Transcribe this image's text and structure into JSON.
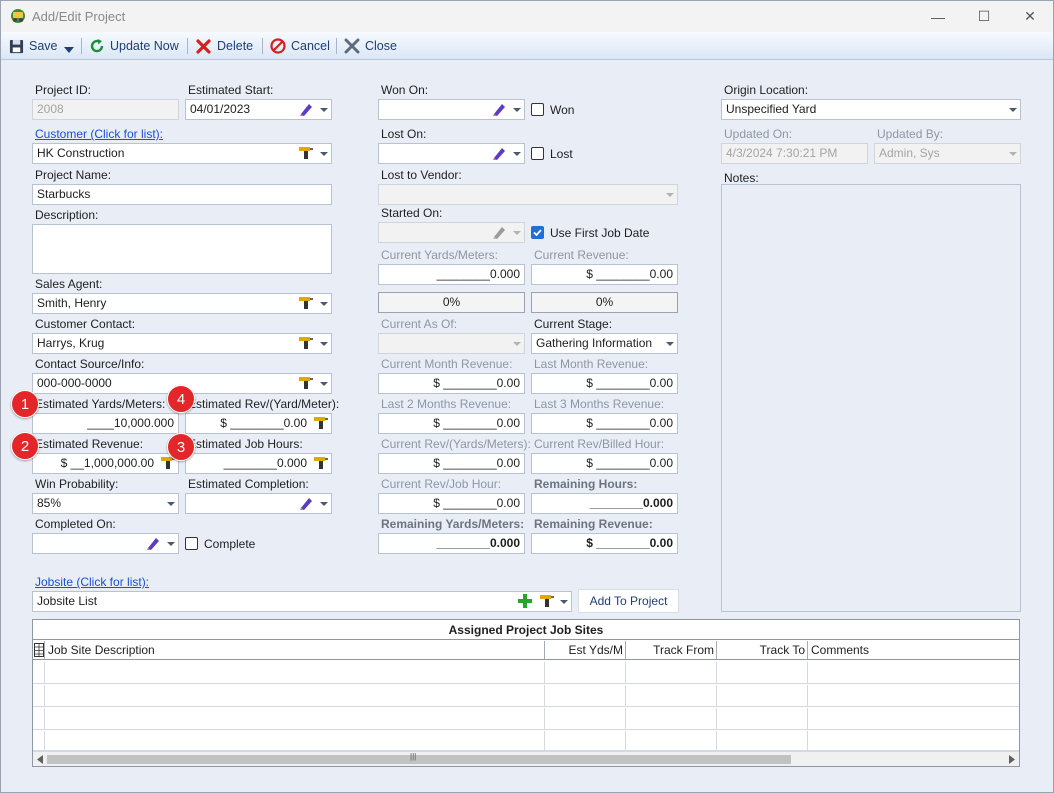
{
  "window": {
    "title": "Add/Edit Project",
    "minimize_glyph": "—",
    "maximize_glyph": "☐",
    "close_glyph": "✕"
  },
  "toolbar": {
    "save_label": "Save",
    "update_label": "Update Now",
    "delete_label": "Delete",
    "cancel_label": "Cancel",
    "close_label": "Close"
  },
  "left": {
    "project_id_label": "Project ID:",
    "project_id": "2008",
    "est_start_label": "Estimated Start:",
    "est_start": "04/01/2023",
    "customer_link": "Customer (Click for list):",
    "customer": "HK Construction",
    "project_name_label": "Project Name:",
    "project_name": "Starbucks",
    "description_label": "Description:",
    "description": "",
    "sales_agent_label": "Sales Agent:",
    "sales_agent": "Smith, Henry",
    "customer_contact_label": "Customer Contact:",
    "customer_contact": "Harrys, Krug",
    "contact_source_label": "Contact Source/Info:",
    "contact_source": "000-000-0000",
    "est_yards_label": "Estimated Yards/Meters:",
    "est_yards": "____10,000.000",
    "est_rev_per_yard_label": "Estimated Rev/(Yard/Meter):",
    "est_rev_per_yard": "$ ________0.00",
    "est_revenue_label": "Estimated Revenue:",
    "est_revenue": "$ __1,000,000.00",
    "est_job_hours_label": "Estimated Job Hours:",
    "est_job_hours": "________0.000",
    "win_prob_label": "Win Probability:",
    "win_prob": "85%",
    "est_completion_label": "Estimated Completion:",
    "est_completion": "",
    "completed_on_label": "Completed On:",
    "completed_on": "",
    "complete_label": "Complete"
  },
  "badges": [
    "1",
    "2",
    "3",
    "4"
  ],
  "middle": {
    "won_on_label": "Won On:",
    "won_label": "Won",
    "lost_on_label": "Lost On:",
    "lost_label": "Lost",
    "lost_vendor_label": "Lost to Vendor:",
    "started_on_label": "Started On:",
    "use_first_job_label": "Use First Job Date",
    "use_first_job_checked": true,
    "cur_yards_label": "Current Yards/Meters:",
    "cur_yards": "________0.000",
    "cur_revenue_label": "Current Revenue:",
    "cur_revenue": "$ ________0.00",
    "pct_yards": "0%",
    "pct_revenue": "0%",
    "cur_as_of_label": "Current As Of:",
    "cur_stage_label": "Current Stage:",
    "cur_stage": "Gathering Information",
    "cur_month_rev_label": "Current Month Revenue:",
    "cur_month_rev": "$ ________0.00",
    "last_month_rev_label": "Last Month Revenue:",
    "last_month_rev": "$ ________0.00",
    "last2_rev_label": "Last 2 Months Revenue:",
    "last2_rev": "$ ________0.00",
    "last3_rev_label": "Last 3 Months Revenue:",
    "last3_rev": "$ ________0.00",
    "cur_rev_yards_label": "Current Rev/(Yards/Meters):",
    "cur_rev_yards": "$ ________0.00",
    "cur_rev_billed_label": "Current Rev/Billed Hour:",
    "cur_rev_billed": "$ ________0.00",
    "cur_rev_job_label": "Current Rev/Job Hour:",
    "cur_rev_job": "$ ________0.00",
    "remaining_hours_label": "Remaining Hours:",
    "remaining_hours": "________0.000",
    "remaining_yards_label": "Remaining Yards/Meters:",
    "remaining_yards": "________0.000",
    "remaining_rev_label": "Remaining Revenue:",
    "remaining_rev": "$ ________0.00"
  },
  "right": {
    "origin_label": "Origin Location:",
    "origin": "Unspecified Yard",
    "updated_on_label": "Updated On:",
    "updated_on": "4/3/2024 7:30:21 PM",
    "updated_by_label": "Updated By:",
    "updated_by": "Admin, Sys",
    "notes_label": "Notes:"
  },
  "jobsite": {
    "link": "Jobsite (Click for list):",
    "value": "Jobsite List",
    "add_button": "Add To Project"
  },
  "grid": {
    "title": "Assigned Project Job Sites",
    "columns": [
      "Job Site Description",
      "Est Yds/M",
      "Track From",
      "Track To",
      "Comments"
    ],
    "scroll_grip": "|||"
  },
  "colors": {
    "accent": "#1a4fd6",
    "badge": "#e3262a",
    "background": "#e9eef6"
  }
}
